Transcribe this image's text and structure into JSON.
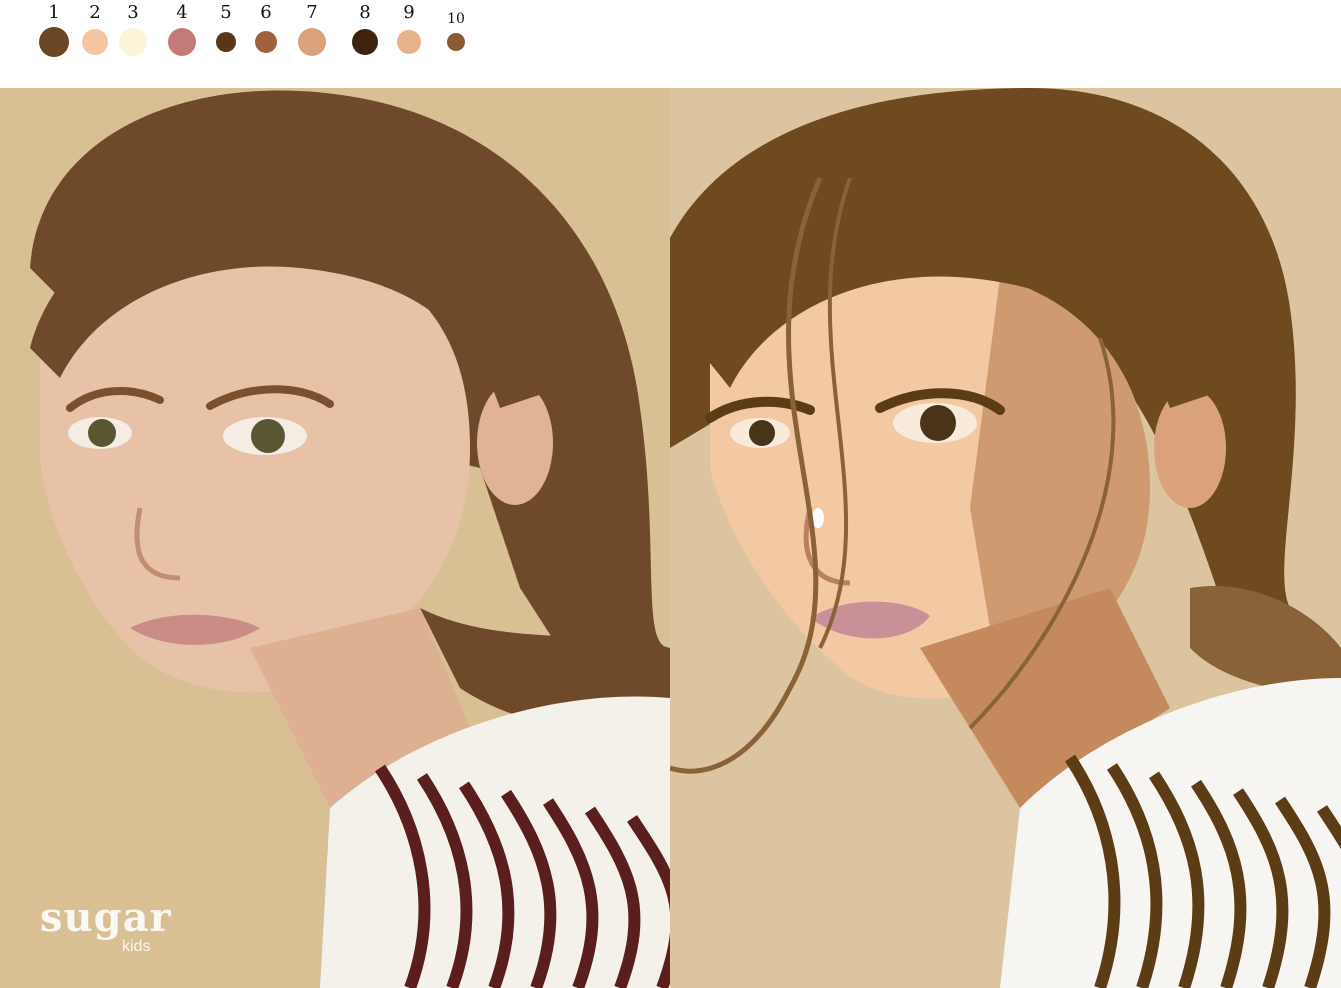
{
  "palette": {
    "swatches": [
      {
        "number": "1",
        "color": "#6b4624"
      },
      {
        "number": "2",
        "color": "#f2c6a0"
      },
      {
        "number": "3",
        "color": "#fbf4d6"
      },
      {
        "number": "4",
        "color": "#c47b78"
      },
      {
        "number": "5",
        "color": "#5a3519"
      },
      {
        "number": "6",
        "color": "#a0623c"
      },
      {
        "number": "7",
        "color": "#d9a27a"
      },
      {
        "number": "8",
        "color": "#3d2210"
      },
      {
        "number": "9",
        "color": "#e9b38a"
      },
      {
        "number": "10",
        "color": "#8a5a35"
      }
    ]
  },
  "photo": {
    "background_color": "#d9bf94",
    "hair_color": "#6e4a2a",
    "skin_color": "#e8c2a6",
    "stripe_color": "#5a1e1e",
    "shirt_color": "#f4f0ea",
    "watermark": {
      "brand": "sugar",
      "sub": "kids"
    }
  },
  "artwork": {
    "background_color": "#dcc4a0",
    "hair_dark": "#6e4a1e",
    "hair_mid": "#8a6238",
    "skin_light": "#f2c9a2",
    "skin_shadow": "#cf9a70",
    "lip_color": "#c99098",
    "stripe_color": "#5c3c14",
    "shirt_color": "#f7f5f2"
  }
}
